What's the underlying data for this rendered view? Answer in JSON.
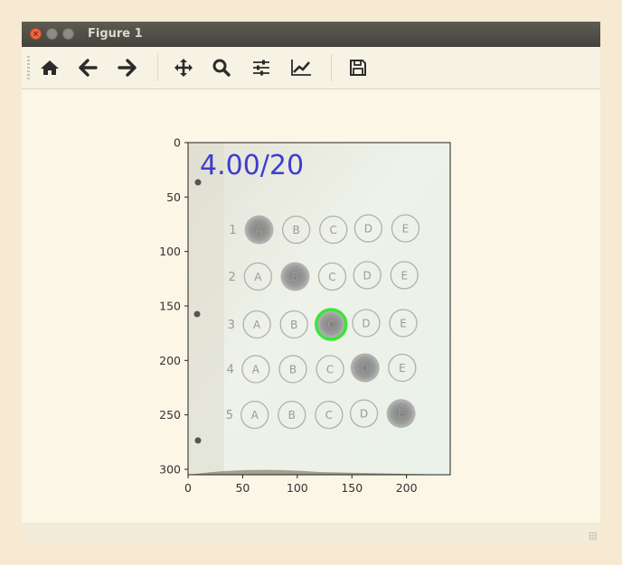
{
  "window": {
    "title": "Figure 1",
    "close_glyph": "×",
    "icons": {
      "close": "close-icon",
      "minimize": "minimize-icon",
      "maximize": "maximize-icon"
    }
  },
  "toolbar": {
    "buttons": [
      {
        "name": "home",
        "icon": "home-icon"
      },
      {
        "name": "back",
        "icon": "back-arrow-icon"
      },
      {
        "name": "forward",
        "icon": "forward-arrow-icon"
      },
      {
        "name": "pan",
        "icon": "move-icon"
      },
      {
        "name": "zoom",
        "icon": "zoom-icon"
      },
      {
        "name": "subplots",
        "icon": "sliders-icon"
      },
      {
        "name": "edit-axes",
        "icon": "line-chart-icon"
      },
      {
        "name": "save",
        "icon": "save-icon"
      }
    ]
  },
  "plot": {
    "xticks": [
      "0",
      "50",
      "100",
      "150",
      "200"
    ],
    "yticks": [
      "0",
      "50",
      "100",
      "150",
      "200",
      "250",
      "300"
    ],
    "xlim": [
      0,
      240
    ],
    "ylim": [
      0,
      305
    ],
    "score_text": "4.00/20",
    "options": [
      "A",
      "B",
      "C",
      "D",
      "E"
    ],
    "questions": [
      {
        "num": "1",
        "filled": "A"
      },
      {
        "num": "2",
        "filled": "B"
      },
      {
        "num": "3",
        "filled": "C",
        "highlight": true
      },
      {
        "num": "4",
        "filled": "D"
      },
      {
        "num": "5",
        "filled": "E"
      }
    ],
    "highlight_color": "#3be43b"
  }
}
